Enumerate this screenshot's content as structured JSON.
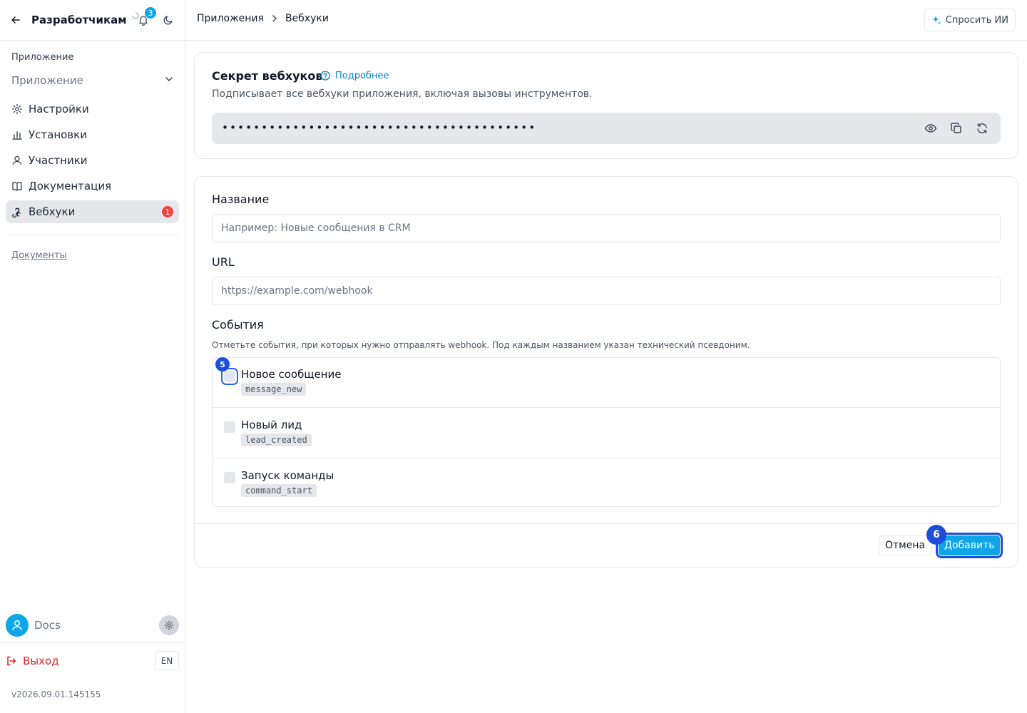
{
  "sidebar": {
    "title": "Разработчикам",
    "notifications_count": "3",
    "section_label": "Приложение",
    "app_select": "Приложение",
    "nav": [
      {
        "label": "Настройки"
      },
      {
        "label": "Установки"
      },
      {
        "label": "Участники"
      },
      {
        "label": "Документация"
      },
      {
        "label": "Вебхуки",
        "badge": "1"
      }
    ],
    "docs_link": "Документы",
    "user_name": "Docs",
    "logout": "Выход",
    "lang": "EN",
    "version": "v2026.09.01.145155"
  },
  "topbar": {
    "breadcrumb": [
      "Приложения",
      "Вебхуки"
    ],
    "ask_ai": "Спросить ИИ"
  },
  "secret_card": {
    "title": "Секрет вебхуков",
    "help": "Подробнее",
    "subtitle": "Подписывает все вебхуки приложения, включая вызовы инструментов.",
    "value": "••••••••••••••••••••••••••••••••••••••••"
  },
  "form": {
    "name_label": "Название",
    "name_placeholder": "Например: Новые сообщения в CRM",
    "url_label": "URL",
    "url_placeholder": "https://example.com/webhook",
    "events_label": "События",
    "events_hint": "Отметьте события, при которых нужно отправлять webhook. Под каждым названием указан технический псевдоним.",
    "events": [
      {
        "name": "Новое сообщение",
        "code": "message_new"
      },
      {
        "name": "Новый лид",
        "code": "lead_created"
      },
      {
        "name": "Запуск команды",
        "code": "command_start"
      }
    ],
    "cancel": "Отмена",
    "submit": "Добавить"
  },
  "markers": {
    "checkbox": "5",
    "submit": "6"
  },
  "colors": {
    "accent": "#0ea5e9",
    "danger": "#dc2626",
    "marker": "#1d4ed8"
  }
}
